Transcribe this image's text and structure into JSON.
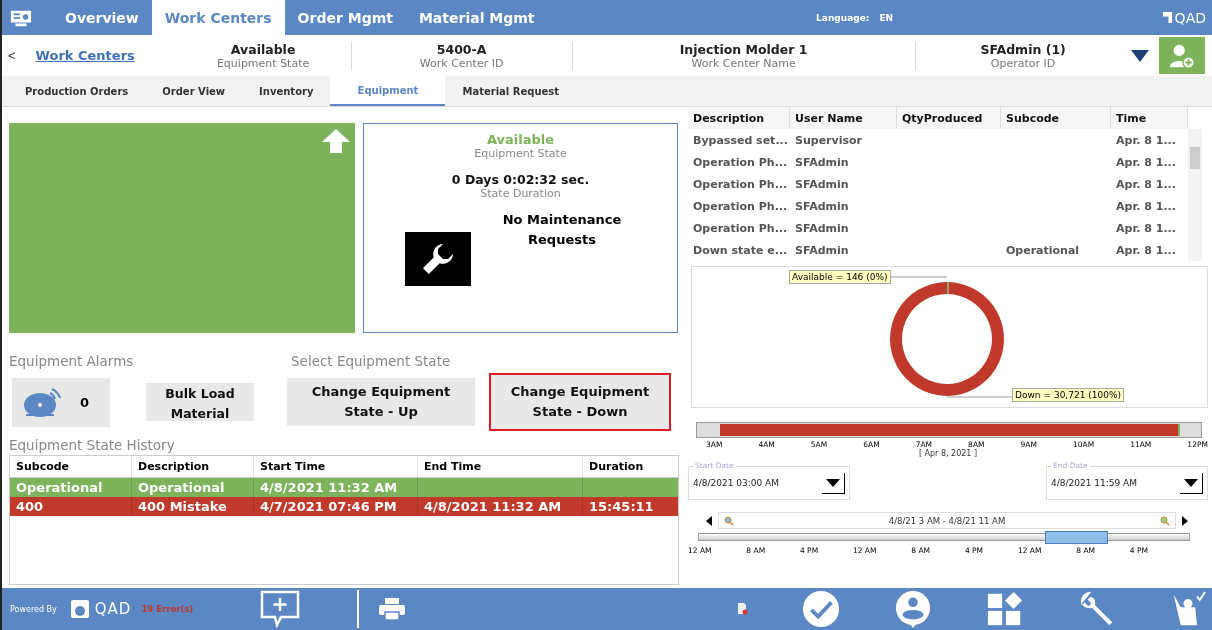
{
  "nav": {
    "tabs": [
      {
        "label": "Overview",
        "selected": false
      },
      {
        "label": "Work Centers",
        "selected": true
      },
      {
        "label": "Order Mgmt",
        "selected": false
      },
      {
        "label": "Material Mgmt",
        "selected": false
      }
    ],
    "language_label": "Language:",
    "language": "EN",
    "brand": "QAD"
  },
  "header": {
    "back": "<",
    "breadcrumb": "Work Centers",
    "fields": [
      {
        "value": "Available",
        "label": "Equipment State"
      },
      {
        "value": "5400-A",
        "label": "Work Center ID"
      },
      {
        "value": "Injection Molder 1",
        "label": "Work Center Name"
      },
      {
        "value": "SFAdmin (1)",
        "label": "Operator ID"
      }
    ]
  },
  "subtabs": [
    {
      "label": "Production Orders",
      "selected": false
    },
    {
      "label": "Order View",
      "selected": false
    },
    {
      "label": "Inventory",
      "selected": false
    },
    {
      "label": "Equipment",
      "selected": true
    },
    {
      "label": "Material Request",
      "selected": false
    }
  ],
  "status_panel": {
    "state": "Available",
    "state_label": "Equipment State",
    "duration": "0 Days 0:02:32 sec.",
    "duration_label": "State Duration",
    "maintenance": "No Maintenance Requests"
  },
  "alarms": {
    "title": "Equipment Alarms",
    "count": "0"
  },
  "bulk_load": "Bulk Load Material",
  "select_state": {
    "title": "Select Equipment State",
    "buttons": [
      {
        "label": "Change Equipment State - Up",
        "selected": false
      },
      {
        "label": "Change Equipment State - Down",
        "selected": true
      }
    ]
  },
  "history": {
    "title": "Equipment State History",
    "columns": [
      "Subcode",
      "Description",
      "Start Time",
      "End Time",
      "Duration"
    ],
    "rows": [
      {
        "color": "#7db35a",
        "cells": [
          "Operational",
          "Operational",
          "4/8/2021 11:32 AM",
          "",
          ""
        ]
      },
      {
        "color": "#c0392b",
        "cells": [
          "400",
          "400 Mistake",
          "4/7/2021 07:46 PM",
          "4/8/2021 11:32 AM",
          "15:45:11"
        ]
      }
    ]
  },
  "events": {
    "columns": [
      "Description",
      "User Name",
      "QtyProduced",
      "Subcode",
      "Time"
    ],
    "rows": [
      [
        "Bypassed set...",
        "Supervisor",
        "",
        "",
        "Apr. 8 1..."
      ],
      [
        "Operation Ph...",
        "SFAdmin",
        "",
        "",
        "Apr. 8 1..."
      ],
      [
        "Operation Ph...",
        "SFAdmin",
        "",
        "",
        "Apr. 8 1..."
      ],
      [
        "Operation Ph...",
        "SFAdmin",
        "",
        "",
        "Apr. 8 1..."
      ],
      [
        "Operation Ph...",
        "SFAdmin",
        "",
        "",
        "Apr. 8 1..."
      ],
      [
        "Down state e...",
        "SFAdmin",
        "",
        "Operational",
        "Apr. 8 1..."
      ]
    ]
  },
  "state_chart": {
    "chart_data": {
      "type": "donut",
      "categories": [
        "Available",
        "Down"
      ],
      "values": [
        146,
        30721
      ],
      "value_labels": [
        "= 146 (0%)",
        "= 30,721 (100%)"
      ]
    }
  },
  "timeline": {
    "ticks": [
      "3AM",
      "4AM",
      "5AM",
      "6AM",
      "7AM",
      "8AM",
      "9AM",
      "10AM",
      "11AM",
      "12PM"
    ],
    "date": "[ Apr 8, 2021 ]"
  },
  "start_date": {
    "label": "Start Date",
    "value": "4/8/2021 03:00 AM"
  },
  "end_date": {
    "label": "End Date",
    "value": "4/8/2021 11:59 AM"
  },
  "navigator": {
    "level": 0.83,
    "range": "4/8/21 3 AM - 4/8/21 11 AM",
    "ticks": [
      "12 AM",
      "8 AM",
      "4 PM",
      "12 AM",
      "8 AM",
      "4 PM",
      "12 AM",
      "8 AM",
      "4 PM"
    ]
  },
  "footer": {
    "powered_by": "Powered By",
    "brand": "QAD",
    "errors": "19 Error(s)"
  }
}
